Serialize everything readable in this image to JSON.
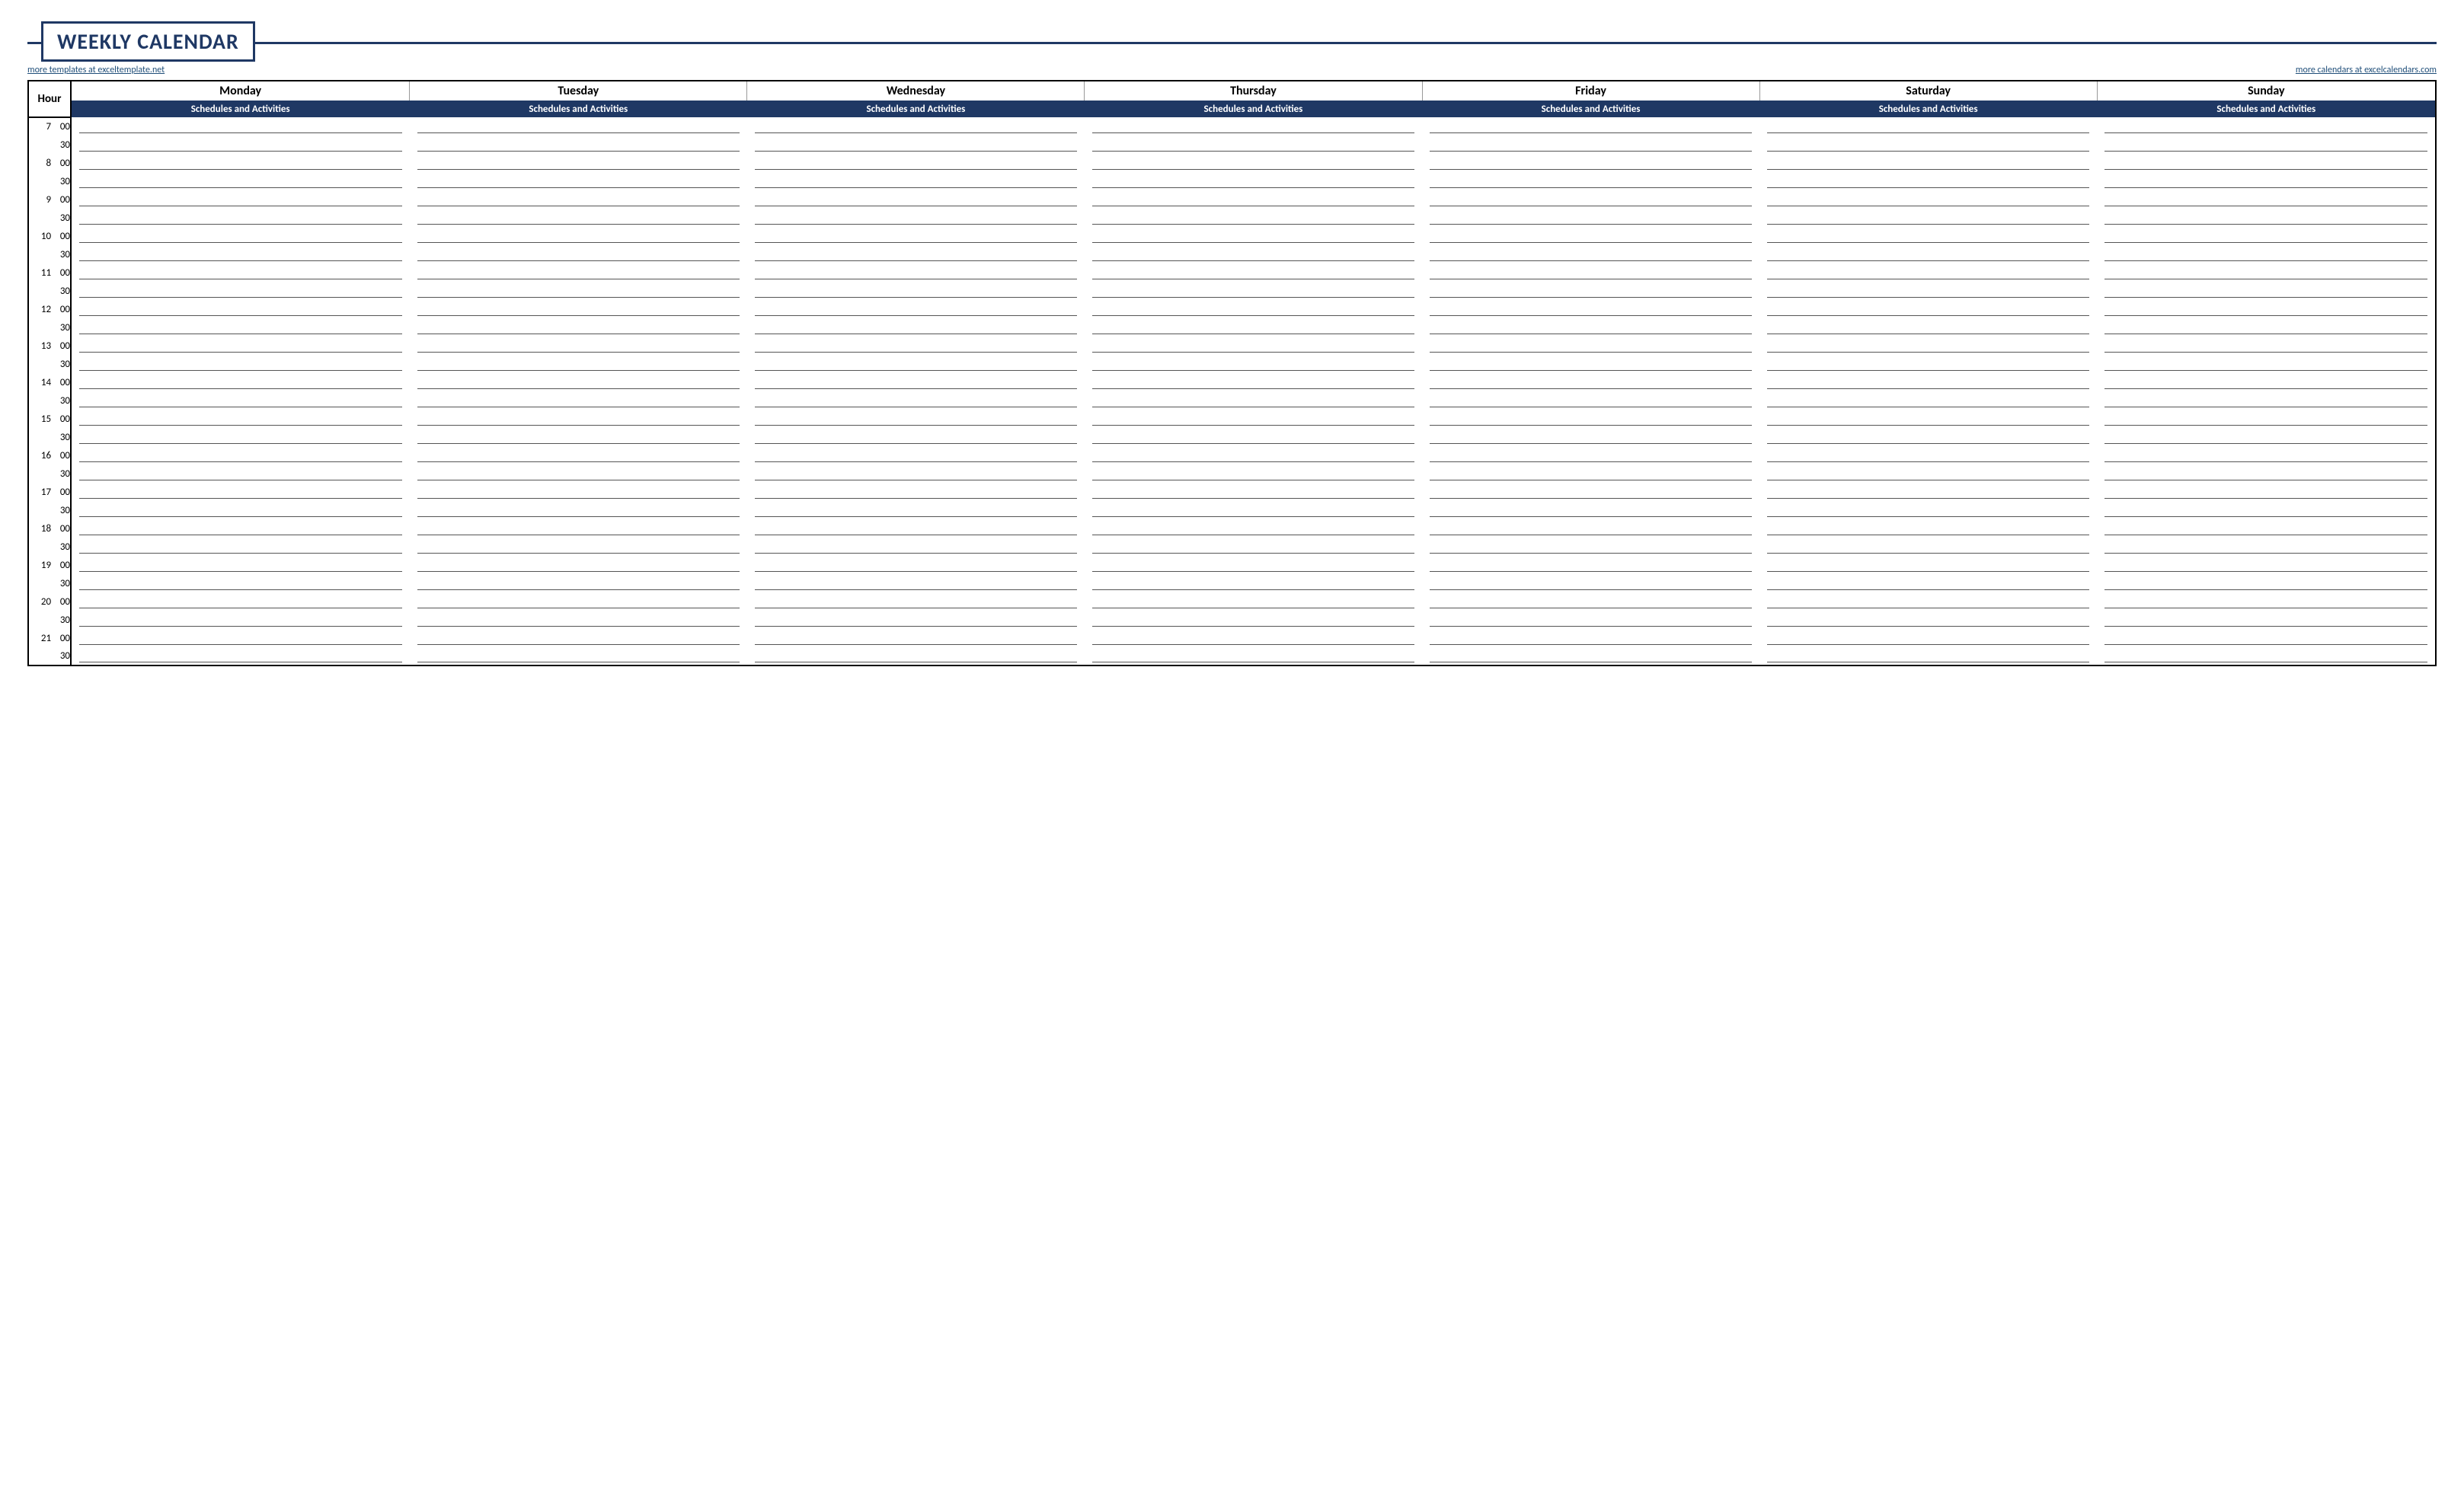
{
  "title": "WEEKLY CALENDAR",
  "link_left": "more templates at exceltemplate.net",
  "link_right": "more calendars at excelcalendars.com",
  "hour_header": "Hour",
  "days": [
    "Monday",
    "Tuesday",
    "Wednesday",
    "Thursday",
    "Friday",
    "Saturday",
    "Sunday"
  ],
  "sub_header": "Schedules and Activities",
  "time_rows": [
    {
      "hour": "7",
      "min": "00"
    },
    {
      "hour": "",
      "min": "30"
    },
    {
      "hour": "8",
      "min": "00"
    },
    {
      "hour": "",
      "min": "30"
    },
    {
      "hour": "9",
      "min": "00"
    },
    {
      "hour": "",
      "min": "30"
    },
    {
      "hour": "10",
      "min": "00"
    },
    {
      "hour": "",
      "min": "30"
    },
    {
      "hour": "11",
      "min": "00"
    },
    {
      "hour": "",
      "min": "30"
    },
    {
      "hour": "12",
      "min": "00"
    },
    {
      "hour": "",
      "min": "30"
    },
    {
      "hour": "13",
      "min": "00"
    },
    {
      "hour": "",
      "min": "30"
    },
    {
      "hour": "14",
      "min": "00"
    },
    {
      "hour": "",
      "min": "30"
    },
    {
      "hour": "15",
      "min": "00"
    },
    {
      "hour": "",
      "min": "30"
    },
    {
      "hour": "16",
      "min": "00"
    },
    {
      "hour": "",
      "min": "30"
    },
    {
      "hour": "17",
      "min": "00"
    },
    {
      "hour": "",
      "min": "30"
    },
    {
      "hour": "18",
      "min": "00"
    },
    {
      "hour": "",
      "min": "30"
    },
    {
      "hour": "19",
      "min": "00"
    },
    {
      "hour": "",
      "min": "30"
    },
    {
      "hour": "20",
      "min": "00"
    },
    {
      "hour": "",
      "min": "30"
    },
    {
      "hour": "21",
      "min": "00"
    },
    {
      "hour": "",
      "min": "30"
    }
  ],
  "entries": {}
}
